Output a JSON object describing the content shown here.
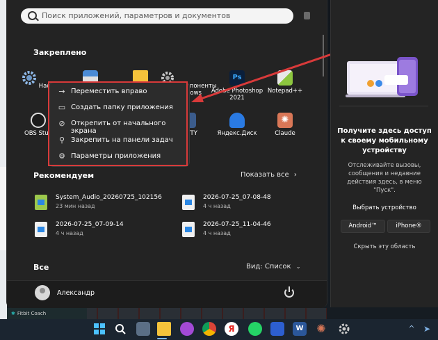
{
  "search": {
    "placeholder": "Поиск приложений, параметров и документов"
  },
  "pinned": {
    "label": "Закреплено",
    "apps": [
      {
        "label": "Настрой",
        "icon": "gear-icon"
      },
      {
        "label": "",
        "icon": "calculator-icon"
      },
      {
        "label": "",
        "icon": "folder-icon"
      },
      {
        "label": "Компоненты Windows",
        "icon": "settings-gear-icon"
      },
      {
        "label": "Adobe Photoshop 2021",
        "icon": "photoshop-icon"
      },
      {
        "label": "Notepad++",
        "icon": "notepadpp-icon"
      },
      {
        "label": "OBS Stud",
        "icon": "obs-icon"
      },
      {
        "label": "PuTTY",
        "icon": "putty-icon"
      },
      {
        "label": "Яндекс.Диск",
        "icon": "yandex-disk-icon"
      },
      {
        "label": "Claude",
        "icon": "claude-icon"
      }
    ]
  },
  "context_menu": {
    "items": [
      {
        "label": "Переместить вправо",
        "icon": "arrow-right-icon"
      },
      {
        "label": "Создать папку приложения",
        "icon": "new-folder-icon"
      },
      {
        "label": "Открепить от начального экрана",
        "icon": "unpin-icon"
      },
      {
        "label": "Закрепить на панели задач",
        "icon": "pin-icon"
      },
      {
        "label": "Параметры приложения",
        "icon": "gear-icon"
      }
    ]
  },
  "recommended": {
    "label": "Рекомендуем",
    "show_all": "Показать все",
    "items": [
      {
        "name": "System_Audio_20260725_102156",
        "time": "23 мин назад"
      },
      {
        "name": "2026-07-25_07-08-48",
        "time": "4 ч назад"
      },
      {
        "name": "2026-07-25_07-09-14",
        "time": "4 ч назад"
      },
      {
        "name": "2026-07-25_11-04-46",
        "time": "4 ч назад"
      }
    ]
  },
  "all": {
    "label": "Все",
    "view": "Вид: Список"
  },
  "user": {
    "name": "Александр"
  },
  "phone_panel": {
    "title": "Получите здесь доступ к своему мобильному устройству",
    "description": "Отслеживайте вызовы, сообщения и недавние действия здесь, в меню \"Пуск\".",
    "choose": "Выбрать устройство",
    "android": "Android™",
    "iphone": "iPhone®",
    "hide": "Скрыть эту область"
  },
  "background_window": {
    "fitbit": "Fitbit Coach"
  },
  "colors": {
    "accent": "#d83a3a",
    "menu_bg": "#232323",
    "taskbar_bg": "#1b2530"
  }
}
